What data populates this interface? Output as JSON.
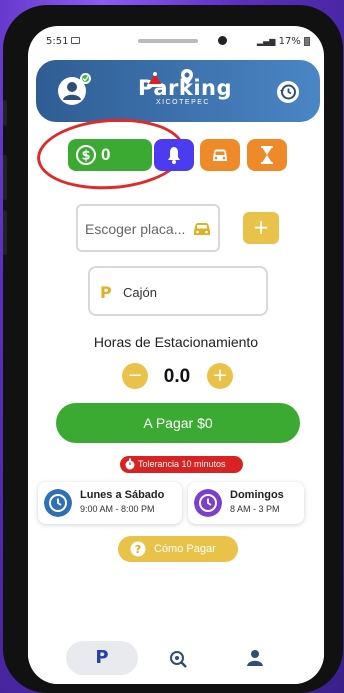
{
  "status_bar": {
    "time": "5:51",
    "right": "17%"
  },
  "header": {
    "logo_main": "Parking",
    "logo_sub": "XICOTEPEC"
  },
  "toolbar": {
    "balance_value": "0"
  },
  "plate": {
    "placeholder": "Escoger placa..."
  },
  "add_label": "+",
  "cajon": {
    "prefix": "P",
    "label": "Cajón"
  },
  "hours": {
    "title": "Horas de Estacionamiento",
    "minus": "−",
    "value": "0.0",
    "plus": "+"
  },
  "pay": {
    "label": "A Pagar $0"
  },
  "tolerance": {
    "label": "Tolerancia 10 minutos"
  },
  "schedules": [
    {
      "title": "Lunes a Sábado",
      "hours": "9:00 AM - 8:00 PM",
      "color": "#2f6fb5"
    },
    {
      "title": "Domingos",
      "hours": "8 AM - 3 PM",
      "color": "#7b3fcf"
    }
  ],
  "how_to_pay": {
    "label": "Cómo Pagar"
  },
  "bottom_nav": {
    "p_label": "P"
  },
  "colors": {
    "green": "#3aaa33",
    "blue_header": "#2f5d93",
    "purple": "#4b3cf0",
    "orange": "#ee8a2a",
    "yellow": "#e9c24a",
    "red": "#d92222"
  }
}
